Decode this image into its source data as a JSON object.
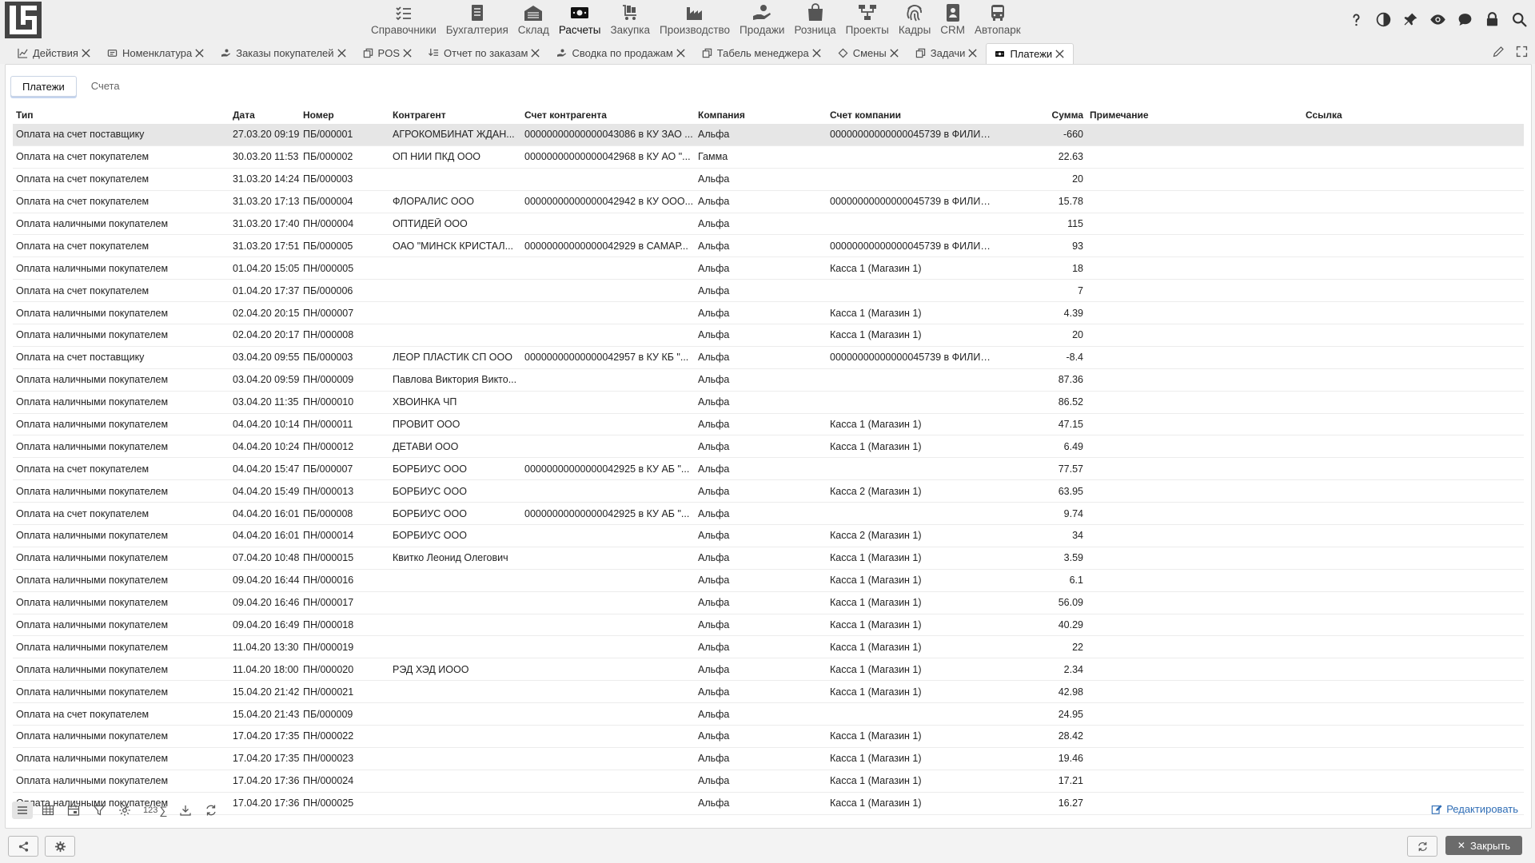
{
  "nav": {
    "items": [
      {
        "label": "Справочники",
        "icon": "list-icon"
      },
      {
        "label": "Бухгалтерия",
        "icon": "ledger-icon"
      },
      {
        "label": "Склад",
        "icon": "warehouse-icon"
      },
      {
        "label": "Расчеты",
        "icon": "banknote-icon"
      },
      {
        "label": "Закупка",
        "icon": "cart-icon"
      },
      {
        "label": "Производство",
        "icon": "factory-icon"
      },
      {
        "label": "Продажи",
        "icon": "hand-coin-icon"
      },
      {
        "label": "Розница",
        "icon": "shopping-bag-icon"
      },
      {
        "label": "Проекты",
        "icon": "hierarchy-icon"
      },
      {
        "label": "Кадры",
        "icon": "fingerprint-icon"
      },
      {
        "label": "CRM",
        "icon": "contact-card-icon"
      },
      {
        "label": "Автопарк",
        "icon": "bus-icon"
      }
    ],
    "active_index": 3
  },
  "tabs": [
    {
      "label": "Действия",
      "icon": "chart-icon"
    },
    {
      "label": "Номенклатура",
      "icon": "catalog-icon"
    },
    {
      "label": "Заказы покупателей",
      "icon": "hand-coin-icon"
    },
    {
      "label": "POS",
      "icon": "copy-icon"
    },
    {
      "label": "Отчет по заказам",
      "icon": "download-list-icon"
    },
    {
      "label": "Сводка по продажам",
      "icon": "hand-coin-icon"
    },
    {
      "label": "Табель менеджера",
      "icon": "copy-icon"
    },
    {
      "label": "Смены",
      "icon": "diamond-icon"
    },
    {
      "label": "Задачи",
      "icon": "copy-icon"
    },
    {
      "label": "Платежи",
      "icon": "banknote-icon"
    }
  ],
  "subtabs": {
    "payments": "Платежи",
    "invoices": "Счета"
  },
  "columns": {
    "type": "Тип",
    "date": "Дата",
    "number": "Номер",
    "counterparty": "Контрагент",
    "counterparty_account": "Счет контрагента",
    "company": "Компания",
    "company_account": "Счет компании",
    "sum": "Сумма",
    "note": "Примечание",
    "link": "Ссылка"
  },
  "rows": [
    {
      "type": "Оплата на счет поставщику",
      "date": "27.03.20 09:19",
      "number": "ПБ/000001",
      "counterparty": "АГРОКОМБИНАТ ЖДАН...",
      "cp_account": "00000000000000043086 в КУ ЗАО ...",
      "company": "Альфа",
      "account": "00000000000000045739 в ФИЛИА...",
      "sum": "-660"
    },
    {
      "type": "Оплата на счет покупателем",
      "date": "30.03.20 11:53",
      "number": "ПБ/000002",
      "counterparty": "ОП НИИ ПКД ООО",
      "cp_account": "00000000000000042968 в КУ АО \"...",
      "company": "Гамма",
      "account": "",
      "sum": "22.63"
    },
    {
      "type": "Оплата на счет покупателем",
      "date": "31.03.20 14:24",
      "number": "ПБ/000003",
      "counterparty": "",
      "cp_account": "",
      "company": "Альфа",
      "account": "",
      "sum": "20"
    },
    {
      "type": "Оплата на счет покупателем",
      "date": "31.03.20 17:13",
      "number": "ПБ/000004",
      "counterparty": "ФЛОРАЛИС ООО",
      "cp_account": "00000000000000042942 в КУ ООО...",
      "company": "Альфа",
      "account": "00000000000000045739 в ФИЛИА...",
      "sum": "15.78"
    },
    {
      "type": "Оплата наличными покупателем",
      "date": "31.03.20 17:40",
      "number": "ПН/000004",
      "counterparty": "ОПТИДЕЙ ООО",
      "cp_account": "",
      "company": "Альфа",
      "account": "",
      "sum": "115"
    },
    {
      "type": "Оплата на счет покупателем",
      "date": "31.03.20 17:51",
      "number": "ПБ/000005",
      "counterparty": "ОАО \"МИНСК КРИСТАЛ...",
      "cp_account": "00000000000000042929 в САМАР...",
      "company": "Альфа",
      "account": "00000000000000045739 в ФИЛИА...",
      "sum": "93"
    },
    {
      "type": "Оплата наличными покупателем",
      "date": "01.04.20 15:05",
      "number": "ПН/000005",
      "counterparty": "",
      "cp_account": "",
      "company": "Альфа",
      "account": "Касса 1 (Магазин 1)",
      "sum": "18"
    },
    {
      "type": "Оплата на счет покупателем",
      "date": "01.04.20 17:37",
      "number": "ПБ/000006",
      "counterparty": "",
      "cp_account": "",
      "company": "Альфа",
      "account": "",
      "sum": "7"
    },
    {
      "type": "Оплата наличными покупателем",
      "date": "02.04.20 20:15",
      "number": "ПН/000007",
      "counterparty": "",
      "cp_account": "",
      "company": "Альфа",
      "account": "Касса 1 (Магазин 1)",
      "sum": "4.39"
    },
    {
      "type": "Оплата наличными покупателем",
      "date": "02.04.20 20:17",
      "number": "ПН/000008",
      "counterparty": "",
      "cp_account": "",
      "company": "Альфа",
      "account": "Касса 1 (Магазин 1)",
      "sum": "20"
    },
    {
      "type": "Оплата на счет поставщику",
      "date": "03.04.20 09:55",
      "number": "ПБ/000003",
      "counterparty": "ЛЕОР ПЛАСТИК СП ООО",
      "cp_account": "00000000000000042957 в КУ КБ \"...",
      "company": "Альфа",
      "account": "00000000000000045739 в ФИЛИА...",
      "sum": "-8.4"
    },
    {
      "type": "Оплата наличными покупателем",
      "date": "03.04.20 09:59",
      "number": "ПН/000009",
      "counterparty": "Павлова Виктория Викто...",
      "cp_account": "",
      "company": "Альфа",
      "account": "",
      "sum": "87.36"
    },
    {
      "type": "Оплата наличными покупателем",
      "date": "03.04.20 11:35",
      "number": "ПН/000010",
      "counterparty": "ХВОИНКА ЧП",
      "cp_account": "",
      "company": "Альфа",
      "account": "",
      "sum": "86.52"
    },
    {
      "type": "Оплата наличными покупателем",
      "date": "04.04.20 10:14",
      "number": "ПН/000011",
      "counterparty": "ПРОВИТ ООО",
      "cp_account": "",
      "company": "Альфа",
      "account": "Касса 1 (Магазин 1)",
      "sum": "47.15"
    },
    {
      "type": "Оплата наличными покупателем",
      "date": "04.04.20 10:24",
      "number": "ПН/000012",
      "counterparty": "ДЕТАВИ ООО",
      "cp_account": "",
      "company": "Альфа",
      "account": "Касса 1 (Магазин 1)",
      "sum": "6.49"
    },
    {
      "type": "Оплата на счет покупателем",
      "date": "04.04.20 15:47",
      "number": "ПБ/000007",
      "counterparty": "БОРБИУС ООО",
      "cp_account": "00000000000000042925 в КУ АБ \"...",
      "company": "Альфа",
      "account": "",
      "sum": "77.57"
    },
    {
      "type": "Оплата наличными покупателем",
      "date": "04.04.20 15:49",
      "number": "ПН/000013",
      "counterparty": "БОРБИУС ООО",
      "cp_account": "",
      "company": "Альфа",
      "account": "Касса 2 (Магазин 1)",
      "sum": "63.95"
    },
    {
      "type": "Оплата на счет покупателем",
      "date": "04.04.20 16:01",
      "number": "ПБ/000008",
      "counterparty": "БОРБИУС ООО",
      "cp_account": "00000000000000042925 в КУ АБ \"...",
      "company": "Альфа",
      "account": "",
      "sum": "9.74"
    },
    {
      "type": "Оплата наличными покупателем",
      "date": "04.04.20 16:01",
      "number": "ПН/000014",
      "counterparty": "БОРБИУС ООО",
      "cp_account": "",
      "company": "Альфа",
      "account": "Касса 2 (Магазин 1)",
      "sum": "34"
    },
    {
      "type": "Оплата наличными покупателем",
      "date": "07.04.20 10:48",
      "number": "ПН/000015",
      "counterparty": "Квитко Леонид Олегович",
      "cp_account": "",
      "company": "Альфа",
      "account": "Касса 1 (Магазин 1)",
      "sum": "3.59"
    },
    {
      "type": "Оплата наличными покупателем",
      "date": "09.04.20 16:44",
      "number": "ПН/000016",
      "counterparty": "",
      "cp_account": "",
      "company": "Альфа",
      "account": "Касса 1 (Магазин 1)",
      "sum": "6.1"
    },
    {
      "type": "Оплата наличными покупателем",
      "date": "09.04.20 16:46",
      "number": "ПН/000017",
      "counterparty": "",
      "cp_account": "",
      "company": "Альфа",
      "account": "Касса 1 (Магазин 1)",
      "sum": "56.09"
    },
    {
      "type": "Оплата наличными покупателем",
      "date": "09.04.20 16:49",
      "number": "ПН/000018",
      "counterparty": "",
      "cp_account": "",
      "company": "Альфа",
      "account": "Касса 1 (Магазин 1)",
      "sum": "40.29"
    },
    {
      "type": "Оплата наличными покупателем",
      "date": "11.04.20 13:30",
      "number": "ПН/000019",
      "counterparty": "",
      "cp_account": "",
      "company": "Альфа",
      "account": "Касса 1 (Магазин 1)",
      "sum": "22"
    },
    {
      "type": "Оплата наличными покупателем",
      "date": "11.04.20 18:00",
      "number": "ПН/000020",
      "counterparty": "РЭД ХЭД ИООО",
      "cp_account": "",
      "company": "Альфа",
      "account": "Касса 1 (Магазин 1)",
      "sum": "2.34"
    },
    {
      "type": "Оплата наличными покупателем",
      "date": "15.04.20 21:42",
      "number": "ПН/000021",
      "counterparty": "",
      "cp_account": "",
      "company": "Альфа",
      "account": "Касса 1 (Магазин 1)",
      "sum": "42.98"
    },
    {
      "type": "Оплата на счет покупателем",
      "date": "15.04.20 21:43",
      "number": "ПБ/000009",
      "counterparty": "",
      "cp_account": "",
      "company": "Альфа",
      "account": "",
      "sum": "24.95"
    },
    {
      "type": "Оплата наличными покупателем",
      "date": "17.04.20 17:35",
      "number": "ПН/000022",
      "counterparty": "",
      "cp_account": "",
      "company": "Альфа",
      "account": "Касса 1 (Магазин 1)",
      "sum": "28.42"
    },
    {
      "type": "Оплата наличными покупателем",
      "date": "17.04.20 17:35",
      "number": "ПН/000023",
      "counterparty": "",
      "cp_account": "",
      "company": "Альфа",
      "account": "Касса 1 (Магазин 1)",
      "sum": "19.46"
    },
    {
      "type": "Оплата наличными покупателем",
      "date": "17.04.20 17:36",
      "number": "ПН/000024",
      "counterparty": "",
      "cp_account": "",
      "company": "Альфа",
      "account": "Касса 1 (Магазин 1)",
      "sum": "17.21"
    },
    {
      "type": "Оплата наличными покупателем",
      "date": "17.04.20 17:36",
      "number": "ПН/000025",
      "counterparty": "",
      "cp_account": "",
      "company": "Альфа",
      "account": "Касса 1 (Магазин 1)",
      "sum": "16.27"
    }
  ],
  "selected_row": 0,
  "toolbar": {
    "sum_label": "123",
    "sum_symbol": "∑",
    "edit_label": "Редактировать"
  },
  "footer": {
    "close_label": "Закрыть"
  },
  "colors": {
    "accent": "#2f6db5",
    "selected_row": "#e6e6e6",
    "close_button": "#6b6b6b"
  }
}
